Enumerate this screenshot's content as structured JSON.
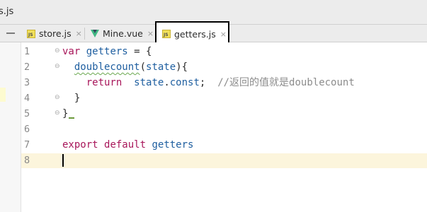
{
  "window": {
    "title": "s.js"
  },
  "tabs": [
    {
      "label": "store.js",
      "icon": "js-file-icon",
      "active": false
    },
    {
      "label": "Mine.vue",
      "icon": "vue-file-icon",
      "active": false
    },
    {
      "label": "getters.js",
      "icon": "js-file-icon",
      "active": true
    }
  ],
  "icons": {
    "js_text": "JS",
    "close": "×"
  },
  "editor": {
    "current_line": 8,
    "lines": [
      {
        "num": "1",
        "tokens": [
          [
            "kw",
            "var"
          ],
          [
            "op",
            " "
          ],
          [
            "var",
            "getters"
          ],
          [
            "op",
            " = {"
          ]
        ]
      },
      {
        "num": "2",
        "tokens": [
          [
            "op",
            "  "
          ],
          [
            "fn",
            "doublecount"
          ],
          [
            "op",
            "("
          ],
          [
            "var",
            "state"
          ],
          [
            "op",
            "){"
          ]
        ]
      },
      {
        "num": "3",
        "tokens": [
          [
            "op",
            "    "
          ],
          [
            "kw",
            "return"
          ],
          [
            "op",
            "  "
          ],
          [
            "var",
            "state"
          ],
          [
            "op",
            "."
          ],
          [
            "var",
            "const"
          ],
          [
            "op",
            ";"
          ]
        ],
        "comment": "//返回的值就是doublecount"
      },
      {
        "num": "4",
        "tokens": [
          [
            "op",
            "  }"
          ]
        ]
      },
      {
        "num": "5",
        "tokens": [
          [
            "op",
            "}"
          ]
        ]
      },
      {
        "num": "6",
        "tokens": []
      },
      {
        "num": "7",
        "tokens": [
          [
            "kw",
            "export"
          ],
          [
            "op",
            " "
          ],
          [
            "kw",
            "default"
          ],
          [
            "op",
            " "
          ],
          [
            "var",
            "getters"
          ]
        ]
      },
      {
        "num": "8",
        "tokens": []
      }
    ]
  }
}
